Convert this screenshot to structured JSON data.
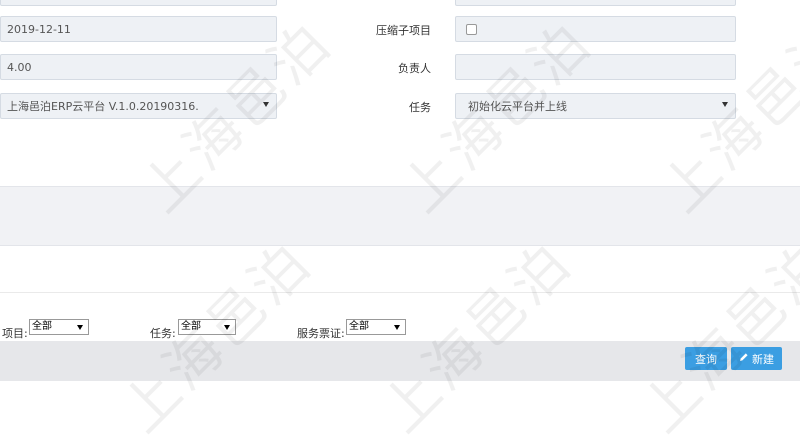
{
  "form": {
    "date_value": "2019-12-11",
    "compress_label": "压缩子项目",
    "hours_value": "4.00",
    "owner_label": "负责人",
    "owner_value": "",
    "project_value": "上海邑泊ERP云平台 V.1.0.20190316.",
    "task_label": "任务",
    "task_value": "初始化云平台并上线"
  },
  "filters": {
    "project_label": "项目:",
    "project_value": "全部",
    "task_label": "任务:",
    "task_value": "全部",
    "ticket_label": "服务票证:",
    "ticket_value": "全部"
  },
  "toolbar": {
    "search_label": "查询",
    "new_label": "新建"
  },
  "watermark": {
    "text": "上海邑泊"
  },
  "colors": {
    "field_bg": "#eef1f5",
    "panel_bg": "#f1f2f5",
    "button_blue": "#3b9ee2"
  }
}
